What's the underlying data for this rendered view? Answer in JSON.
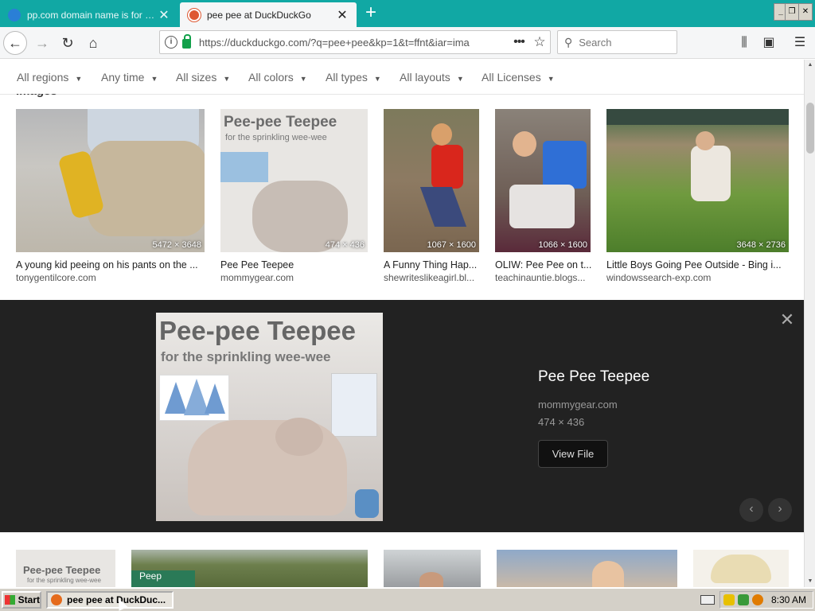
{
  "browser": {
    "tabs": [
      {
        "title": "pp.com domain name is for sale. In",
        "active": false,
        "icon": "globe-icon"
      },
      {
        "title": "pee pee at DuckDuckGo",
        "active": true,
        "icon": "duckduckgo-icon"
      }
    ],
    "new_tab": "+",
    "url": "https://duckduckgo.com/?q=pee+pee&kp=1&t=ffnt&iar=ima",
    "search_placeholder": "Search"
  },
  "filters": [
    {
      "label": "All regions"
    },
    {
      "label": "Any time"
    },
    {
      "label": "All sizes"
    },
    {
      "label": "All colors"
    },
    {
      "label": "All types"
    },
    {
      "label": "All layouts"
    },
    {
      "label": "All Licenses"
    }
  ],
  "images_heading": "Images",
  "results": [
    {
      "title": "A young kid peeing on his pants on the ...",
      "source": "tonygentilcore.com",
      "dims": "5472 × 3648"
    },
    {
      "title": "Pee Pee Teepee",
      "source": "mommygear.com",
      "dims": "474 × 436"
    },
    {
      "title": "A Funny Thing Hap...",
      "source": "shewriteslikeagirl.bl...",
      "dims": "1067 × 1600"
    },
    {
      "title": "OLIW: Pee Pee on t...",
      "source": "teachinauntie.blogs...",
      "dims": "1066 × 1600"
    },
    {
      "title": "Little Boys Going Pee Outside - Bing i...",
      "source": "windowssearch-exp.com",
      "dims": "3648 × 2736"
    }
  ],
  "detail": {
    "image_headline": "Pee-pee Teepee",
    "image_subline": "for the sprinkling wee-wee",
    "title": "Pee Pee Teepee",
    "source": "mommygear.com",
    "dims": "474 × 436",
    "view_file_label": "View File"
  },
  "bottom_row": {
    "first_caption_1": "Pee-pee Teepee",
    "first_caption_2": "for the sprinkling wee-wee",
    "sign_text": "Peep"
  },
  "taskbar": {
    "start_label": "Start",
    "task_label": "pee pee at DuckDuc...",
    "clock": "8:30 AM"
  }
}
